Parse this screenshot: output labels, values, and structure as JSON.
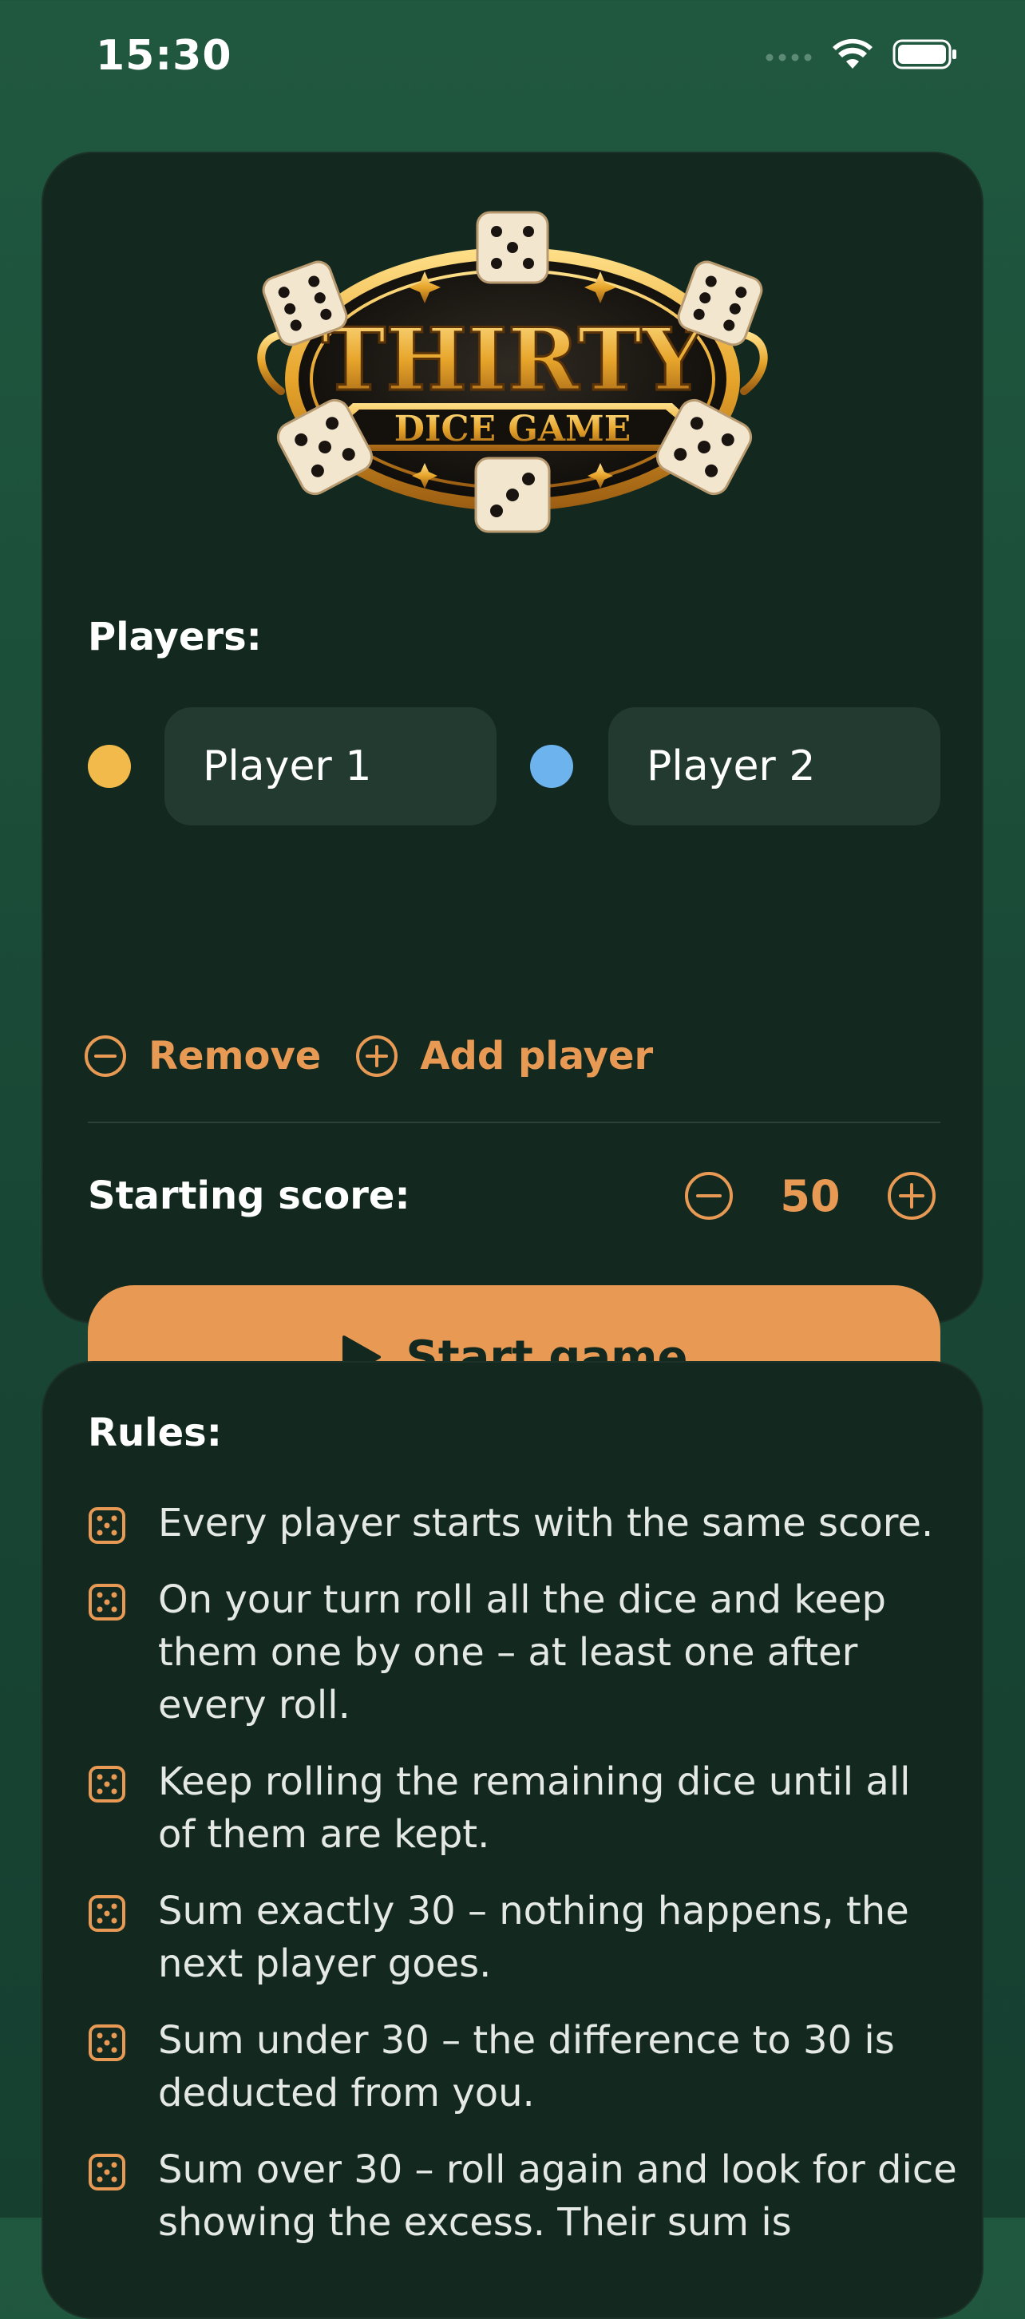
{
  "status_bar": {
    "time": "15:30"
  },
  "setup": {
    "logo_title": "THIRTY",
    "logo_subtitle": "DICE GAME",
    "players_label": "Players:",
    "players": [
      {
        "name": "Player 1",
        "color": "#f2b94b"
      },
      {
        "name": "Player 2",
        "color": "#6db3ee"
      }
    ],
    "remove_label": "Remove",
    "add_player_label": "Add player",
    "starting_score_label": "Starting score:",
    "starting_score": "50",
    "start_button_label": "Start game"
  },
  "rules": {
    "title": "Rules:",
    "items": [
      "Every player starts with the same score.",
      "On your turn roll all the dice and keep them one by one – at least one after every roll.",
      "Keep rolling the remaining dice until all of them are kept.",
      "Sum exactly 30 – nothing happens, the next player goes.",
      "Sum under 30 – the difference to 30 is deducted from you.",
      "Sum over 30 – roll again and look for dice showing the excess. Their sum is"
    ]
  },
  "colors": {
    "accent": "#e89a55",
    "card": "#13291f",
    "field": "#233a30"
  }
}
